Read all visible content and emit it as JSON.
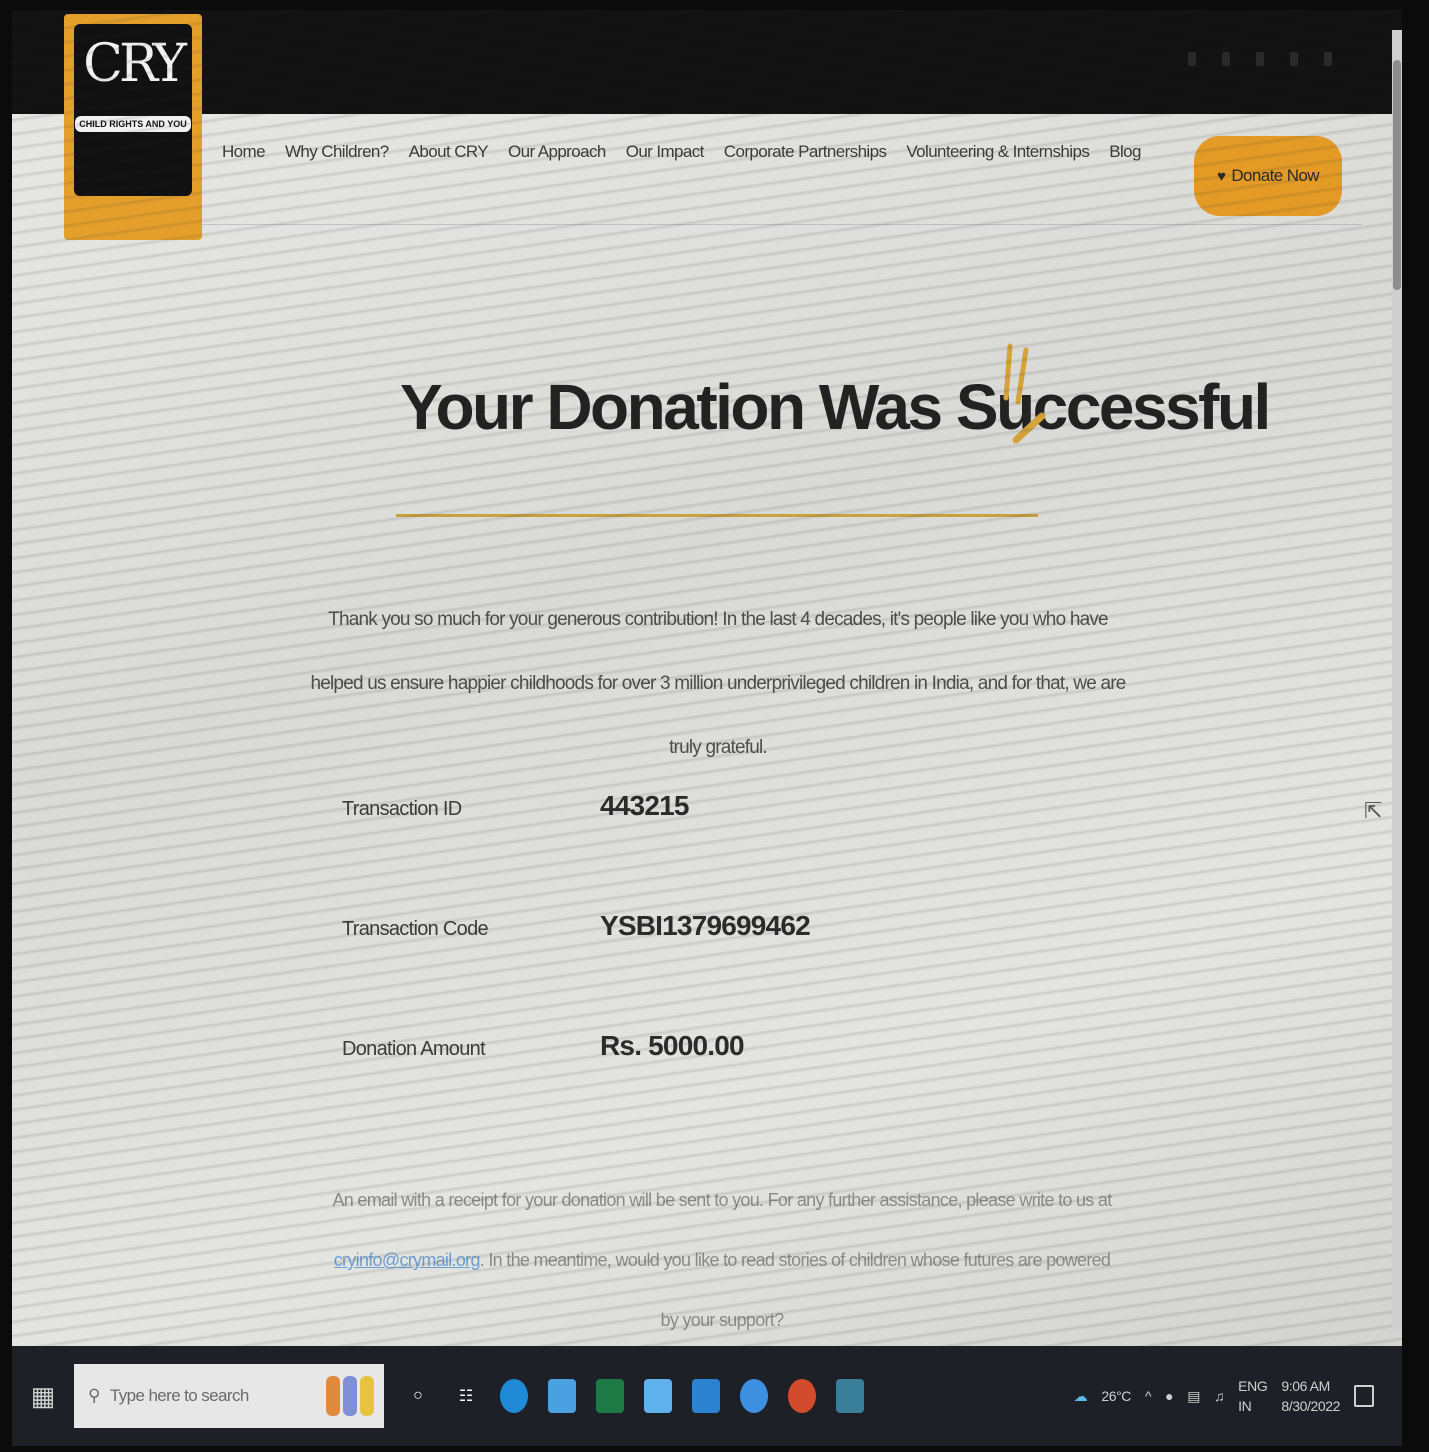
{
  "logo": {
    "mark": "CRY",
    "tagline": "CHILD RIGHTS AND YOU"
  },
  "nav": {
    "items": [
      {
        "label": "Home"
      },
      {
        "label": "Why Children?"
      },
      {
        "label": "About CRY"
      },
      {
        "label": "Our Approach"
      },
      {
        "label": "Our Impact"
      },
      {
        "label": "Corporate Partnerships"
      },
      {
        "label": "Volunteering & Internships"
      },
      {
        "label": "Blog"
      }
    ],
    "donate_label": "Donate Now",
    "donate_icon": "heart-icon"
  },
  "main": {
    "title": "Your Donation Was Successful",
    "thanks": "Thank you so much for your generous contribution! In the last 4 decades, it's people like you who have helped us ensure happier childhoods for over 3 million underprivileged children in India, and for that, we are truly grateful.",
    "details": [
      {
        "label": "Transaction ID",
        "value": "443215"
      },
      {
        "label": "Transaction Code",
        "value": "YSBI1379699462"
      },
      {
        "label": "Donation Amount",
        "value": "Rs. 5000.00"
      }
    ],
    "footer_part1": "An email with a receipt for your donation will be sent to you. For any further assistance, please write to us at",
    "footer_email": "cryinfo@crymail.org",
    "footer_part2": ". In the meantime, would you like to read stories of children whose futures are powered by your support?"
  },
  "taskbar": {
    "search_placeholder": "Type here to search",
    "weather": "26°C",
    "lang_top": "ENG",
    "lang_bottom": "IN",
    "time": "9:06 AM",
    "date": "8/30/2022"
  },
  "colors": {
    "accent": "#e39b26",
    "topbar": "#121212",
    "gold_rule": "#c9a13f",
    "taskbar": "#1d2026"
  }
}
